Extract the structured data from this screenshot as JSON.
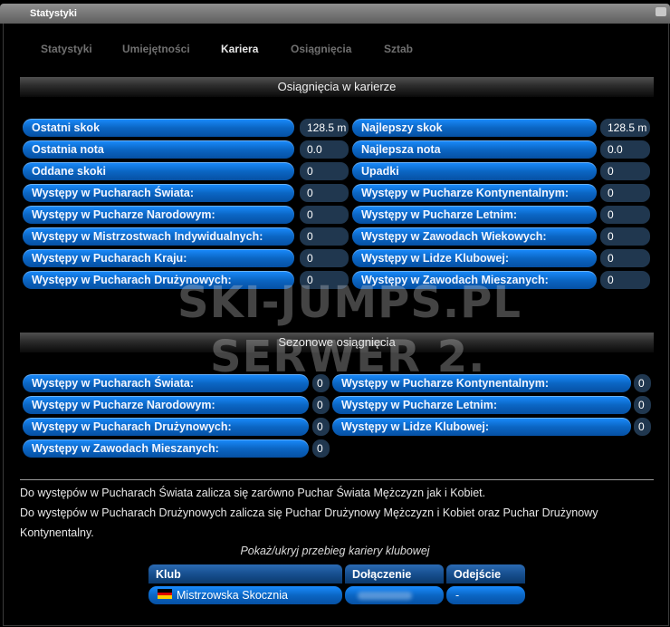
{
  "window": {
    "title": "Statystyki"
  },
  "tabs": [
    {
      "label": "Statystyki",
      "active": false
    },
    {
      "label": "Umiejętności",
      "active": false
    },
    {
      "label": "Kariera",
      "active": true
    },
    {
      "label": "Osiągnięcia",
      "active": false
    },
    {
      "label": "Sztab",
      "active": false
    }
  ],
  "career": {
    "header": "Osiągnięcia w karierze",
    "rows": [
      {
        "left_label": "Ostatni skok",
        "left_value": "128.5 m",
        "right_label": "Najlepszy skok",
        "right_value": "128.5 m"
      },
      {
        "left_label": "Ostatnia nota",
        "left_value": "0.0",
        "right_label": "Najlepsza nota",
        "right_value": "0.0"
      },
      {
        "left_label": "Oddane skoki",
        "left_value": "0",
        "right_label": "Upadki",
        "right_value": "0"
      },
      {
        "left_label": "Występy w Pucharach Świata:",
        "left_value": "0",
        "right_label": "Występy w Pucharze Kontynentalnym:",
        "right_value": "0"
      },
      {
        "left_label": "Występy w Pucharze Narodowym:",
        "left_value": "0",
        "right_label": "Występy w Pucharze Letnim:",
        "right_value": "0"
      },
      {
        "left_label": "Występy w Mistrzostwach Indywidualnych:",
        "left_value": "0",
        "right_label": "Występy w Zawodach Wiekowych:",
        "right_value": "0"
      },
      {
        "left_label": "Występy w Pucharach Kraju:",
        "left_value": "0",
        "right_label": "Występy w Lidze Klubowej:",
        "right_value": "0"
      },
      {
        "left_label": "Występy w Pucharach Drużynowych:",
        "left_value": "0",
        "right_label": "Występy w Zawodach Mieszanych:",
        "right_value": "0"
      }
    ]
  },
  "season": {
    "header": "Sezonowe osiągnięcia",
    "rows": [
      {
        "left_label": "Występy w Pucharach Świata:",
        "left_value": "0",
        "right_label": "Występy w Pucharze Kontynentalnym:",
        "right_value": "0"
      },
      {
        "left_label": "Występy w Pucharze Narodowym:",
        "left_value": "0",
        "right_label": "Występy w Pucharze Letnim:",
        "right_value": "0"
      },
      {
        "left_label": "Występy w Pucharach Drużynowych:",
        "left_value": "0",
        "right_label": "Występy w Lidze Klubowej:",
        "right_value": "0"
      },
      {
        "left_label": "Występy w Zawodach Mieszanych:",
        "left_value": "0"
      }
    ]
  },
  "watermark": {
    "line1": "SKI-JUMPS.PL",
    "line2": "SERWER 2."
  },
  "notes": {
    "line1": "Do występów w Pucharach Świata zalicza się zarówno Puchar Świata Mężczyzn jak i Kobiet.",
    "line2": "Do występów w Pucharach Drużynowych zalicza się Puchar Drużynowy Mężczyzn i Kobiet oraz Puchar Drużynowy Kontynentalny."
  },
  "club_history": {
    "toggle": "Pokaż/ukryj przebieg kariery klubowej",
    "columns": [
      "Klub",
      "Dołączenie",
      "Odejście"
    ],
    "rows": [
      {
        "club": "Mistrzowska Skocznia",
        "flag": "germany-flag",
        "joined": "",
        "left": "-"
      }
    ]
  },
  "colors": {
    "accent": "#0b66c4",
    "value_bg": "#20374f",
    "header_bg": "#2b2b2b"
  }
}
